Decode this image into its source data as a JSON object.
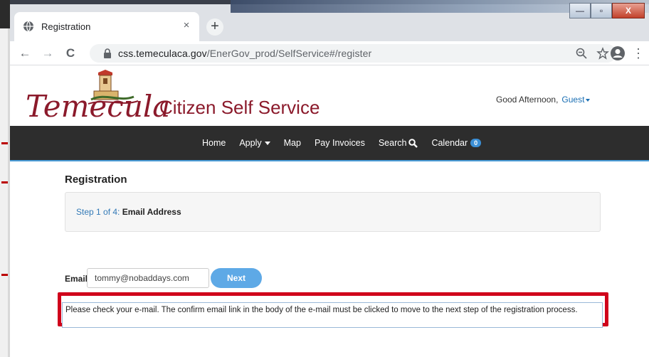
{
  "browser": {
    "tab_title": "Registration",
    "tab_close": "×",
    "new_tab": "+",
    "url_host": "css.temeculaca.gov",
    "url_path": "/EnerGov_prod/SelfService#/register",
    "nav_back": "←",
    "nav_forward": "→",
    "nav_reload": "C",
    "window_minimize": "—",
    "window_maximize": "▫",
    "window_close": "X",
    "menu": "⋮"
  },
  "site": {
    "logo_script": "Temecula",
    "logo_title": "Citizen Self Service",
    "greeting": "Good Afternoon,",
    "guest_label": "Guest"
  },
  "nav": {
    "items": [
      {
        "label": "Home"
      },
      {
        "label": "Apply"
      },
      {
        "label": "Map"
      },
      {
        "label": "Pay Invoices"
      },
      {
        "label": "Search"
      },
      {
        "label": "Calendar"
      }
    ],
    "calendar_badge": "0"
  },
  "registration": {
    "title": "Registration",
    "step_number": "Step 1 of 4:",
    "step_name": "Email Address",
    "email_label": "Email",
    "email_value": "tommy@nobaddays.com",
    "next_label": "Next",
    "message": "Please check your e-mail. The confirm email link in the body of the e-mail must be clicked to move to the next step of the registration process."
  },
  "colors": {
    "navbar": "#2d2d2d",
    "accent": "#5ea9e6",
    "brand": "#8b1a2b",
    "highlight": "#d0021b"
  }
}
